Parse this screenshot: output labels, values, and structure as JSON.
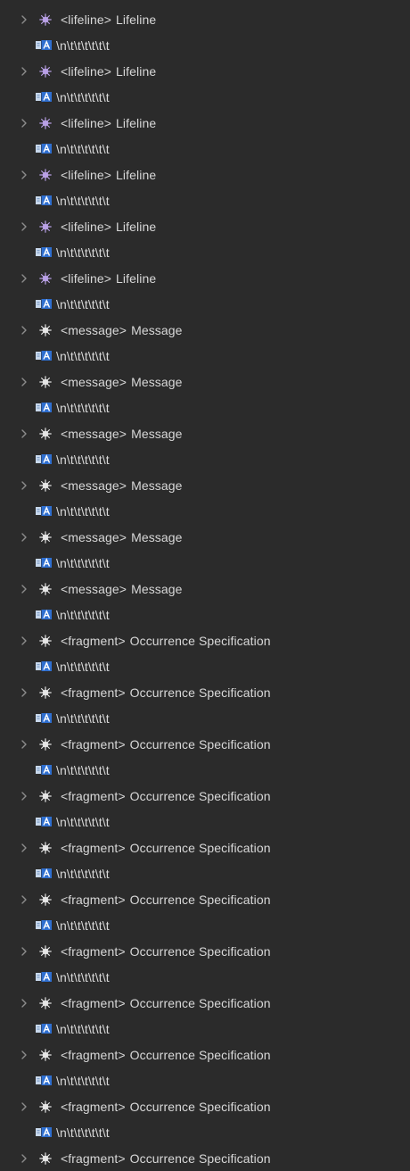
{
  "tree": {
    "items": [
      {
        "kind": "element",
        "tag": "<lifeline>",
        "name": "Lifeline",
        "icon": "lifeline-node-icon"
      },
      {
        "kind": "text",
        "value": "\\n\\t\\t\\t\\t\\t\\t",
        "icon": "text-node-icon"
      },
      {
        "kind": "element",
        "tag": "<lifeline>",
        "name": "Lifeline",
        "icon": "lifeline-node-icon"
      },
      {
        "kind": "text",
        "value": "\\n\\t\\t\\t\\t\\t\\t",
        "icon": "text-node-icon"
      },
      {
        "kind": "element",
        "tag": "<lifeline>",
        "name": "Lifeline",
        "icon": "lifeline-node-icon"
      },
      {
        "kind": "text",
        "value": "\\n\\t\\t\\t\\t\\t\\t",
        "icon": "text-node-icon"
      },
      {
        "kind": "element",
        "tag": "<lifeline>",
        "name": "Lifeline",
        "icon": "lifeline-node-icon"
      },
      {
        "kind": "text",
        "value": "\\n\\t\\t\\t\\t\\t\\t",
        "icon": "text-node-icon"
      },
      {
        "kind": "element",
        "tag": "<lifeline>",
        "name": "Lifeline",
        "icon": "lifeline-node-icon"
      },
      {
        "kind": "text",
        "value": "\\n\\t\\t\\t\\t\\t\\t",
        "icon": "text-node-icon"
      },
      {
        "kind": "element",
        "tag": "<lifeline>",
        "name": "Lifeline",
        "icon": "lifeline-node-icon"
      },
      {
        "kind": "text",
        "value": "\\n\\t\\t\\t\\t\\t\\t",
        "icon": "text-node-icon"
      },
      {
        "kind": "element",
        "tag": "<message>",
        "name": "Message",
        "icon": "message-node-icon"
      },
      {
        "kind": "text",
        "value": "\\n\\t\\t\\t\\t\\t\\t",
        "icon": "text-node-icon"
      },
      {
        "kind": "element",
        "tag": "<message>",
        "name": "Message",
        "icon": "message-node-icon"
      },
      {
        "kind": "text",
        "value": "\\n\\t\\t\\t\\t\\t\\t",
        "icon": "text-node-icon"
      },
      {
        "kind": "element",
        "tag": "<message>",
        "name": "Message",
        "icon": "message-node-icon"
      },
      {
        "kind": "text",
        "value": "\\n\\t\\t\\t\\t\\t\\t",
        "icon": "text-node-icon"
      },
      {
        "kind": "element",
        "tag": "<message>",
        "name": "Message",
        "icon": "message-node-icon"
      },
      {
        "kind": "text",
        "value": "\\n\\t\\t\\t\\t\\t\\t",
        "icon": "text-node-icon"
      },
      {
        "kind": "element",
        "tag": "<message>",
        "name": "Message",
        "icon": "message-node-icon"
      },
      {
        "kind": "text",
        "value": "\\n\\t\\t\\t\\t\\t\\t",
        "icon": "text-node-icon"
      },
      {
        "kind": "element",
        "tag": "<message>",
        "name": "Message",
        "icon": "message-node-icon"
      },
      {
        "kind": "text",
        "value": "\\n\\t\\t\\t\\t\\t\\t",
        "icon": "text-node-icon"
      },
      {
        "kind": "element",
        "tag": "<fragment>",
        "name": "Occurrence Specification",
        "icon": "fragment-node-icon"
      },
      {
        "kind": "text",
        "value": "\\n\\t\\t\\t\\t\\t\\t",
        "icon": "text-node-icon"
      },
      {
        "kind": "element",
        "tag": "<fragment>",
        "name": "Occurrence Specification",
        "icon": "fragment-node-icon"
      },
      {
        "kind": "text",
        "value": "\\n\\t\\t\\t\\t\\t\\t",
        "icon": "text-node-icon"
      },
      {
        "kind": "element",
        "tag": "<fragment>",
        "name": "Occurrence Specification",
        "icon": "fragment-node-icon"
      },
      {
        "kind": "text",
        "value": "\\n\\t\\t\\t\\t\\t\\t",
        "icon": "text-node-icon"
      },
      {
        "kind": "element",
        "tag": "<fragment>",
        "name": "Occurrence Specification",
        "icon": "fragment-node-icon"
      },
      {
        "kind": "text",
        "value": "\\n\\t\\t\\t\\t\\t\\t",
        "icon": "text-node-icon"
      },
      {
        "kind": "element",
        "tag": "<fragment>",
        "name": "Occurrence Specification",
        "icon": "fragment-node-icon"
      },
      {
        "kind": "text",
        "value": "\\n\\t\\t\\t\\t\\t\\t",
        "icon": "text-node-icon"
      },
      {
        "kind": "element",
        "tag": "<fragment>",
        "name": "Occurrence Specification",
        "icon": "fragment-node-icon"
      },
      {
        "kind": "text",
        "value": "\\n\\t\\t\\t\\t\\t\\t",
        "icon": "text-node-icon"
      },
      {
        "kind": "element",
        "tag": "<fragment>",
        "name": "Occurrence Specification",
        "icon": "fragment-node-icon"
      },
      {
        "kind": "text",
        "value": "\\n\\t\\t\\t\\t\\t\\t",
        "icon": "text-node-icon"
      },
      {
        "kind": "element",
        "tag": "<fragment>",
        "name": "Occurrence Specification",
        "icon": "fragment-node-icon"
      },
      {
        "kind": "text",
        "value": "\\n\\t\\t\\t\\t\\t\\t",
        "icon": "text-node-icon"
      },
      {
        "kind": "element",
        "tag": "<fragment>",
        "name": "Occurrence Specification",
        "icon": "fragment-node-icon"
      },
      {
        "kind": "text",
        "value": "\\n\\t\\t\\t\\t\\t\\t",
        "icon": "text-node-icon"
      },
      {
        "kind": "element",
        "tag": "<fragment>",
        "name": "Occurrence Specification",
        "icon": "fragment-node-icon"
      },
      {
        "kind": "text",
        "value": "\\n\\t\\t\\t\\t\\t\\t",
        "icon": "text-node-icon"
      },
      {
        "kind": "element",
        "tag": "<fragment>",
        "name": "Occurrence Specification",
        "icon": "fragment-node-icon"
      }
    ]
  },
  "colors": {
    "background": "#2b2b2b",
    "text": "#d8d8d8",
    "chevron": "#8c8c8c",
    "lifeline_icon": "#b9a0e6",
    "message_icon": "#e6e6e6",
    "fragment_icon": "#e6e6e6",
    "text_icon_light": "#c8d8ec",
    "text_icon_blue": "#2f6fd0"
  }
}
